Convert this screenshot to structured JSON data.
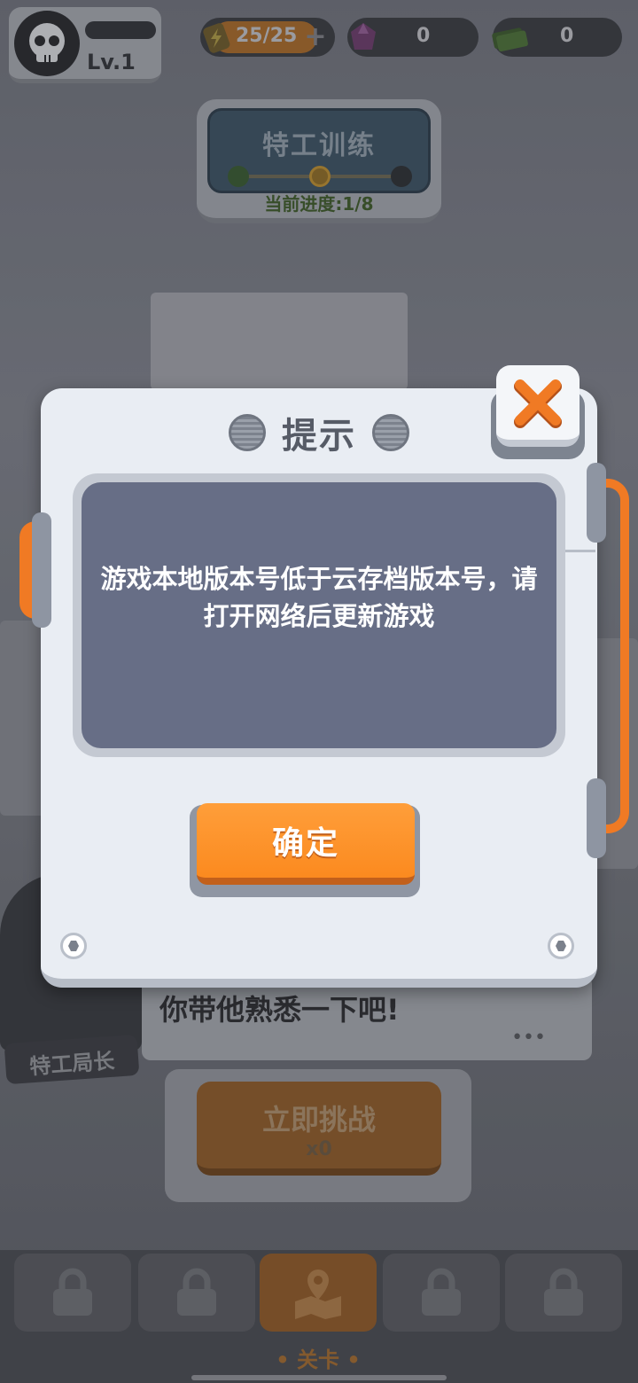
{
  "hud": {
    "level": "Lv.1",
    "energy": "25/25",
    "energy_plus": "+",
    "gems": "0",
    "cash": "0"
  },
  "training": {
    "title": "特工训练",
    "progress": "当前进度:1/8"
  },
  "chat": {
    "text": "你带他熟悉一下吧!",
    "dots": "•••",
    "speaker": "特工局长"
  },
  "challenge": {
    "label": "立即挑战",
    "cost": "x0"
  },
  "bottom_nav": {
    "tabs": [
      {
        "label": "",
        "icon": "lock-icon"
      },
      {
        "label": "",
        "icon": "lock-icon"
      },
      {
        "label": "关卡",
        "icon": "map-pin-icon"
      },
      {
        "label": "",
        "icon": "lock-icon"
      },
      {
        "label": "",
        "icon": "lock-icon"
      }
    ],
    "active_label": "• 关卡 •"
  },
  "dialog": {
    "title": "提示",
    "message": "游戏本地版本号低于云存档版本号，请打开网络后更新游戏",
    "confirm_label": "确定",
    "close_icon": "close-x-icon"
  },
  "colors": {
    "accent_orange": "#fb8a1f",
    "message_bg": "#676e86",
    "dialog_bg": "#e9edf3"
  }
}
